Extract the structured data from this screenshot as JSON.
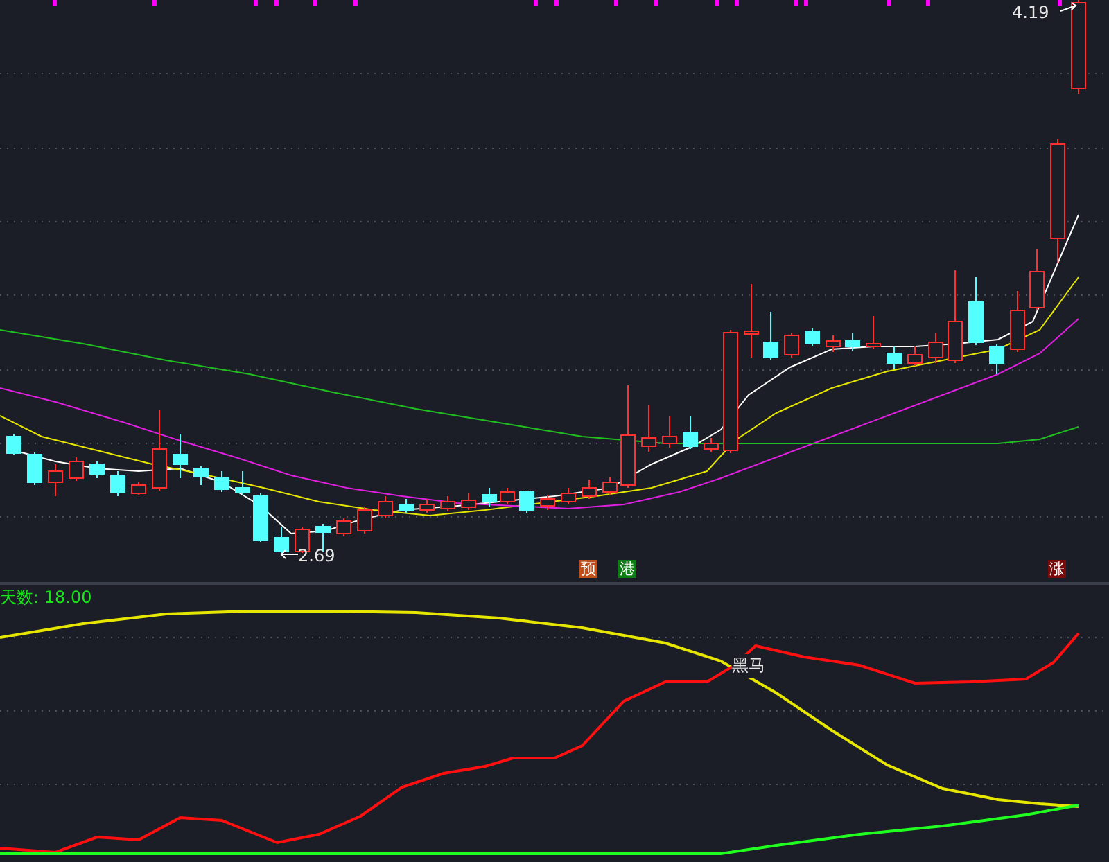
{
  "price_chart": {
    "high_label": "4.19",
    "low_label": "2.69",
    "signals": [
      {
        "text": "预",
        "color": "#c0501a"
      },
      {
        "text": "港",
        "color": "#0b7d12"
      },
      {
        "text": "涨",
        "color": "#7a0a0a"
      }
    ]
  },
  "indicator": {
    "title": "天数: 18.00",
    "cross_label": "黑马"
  }
}
